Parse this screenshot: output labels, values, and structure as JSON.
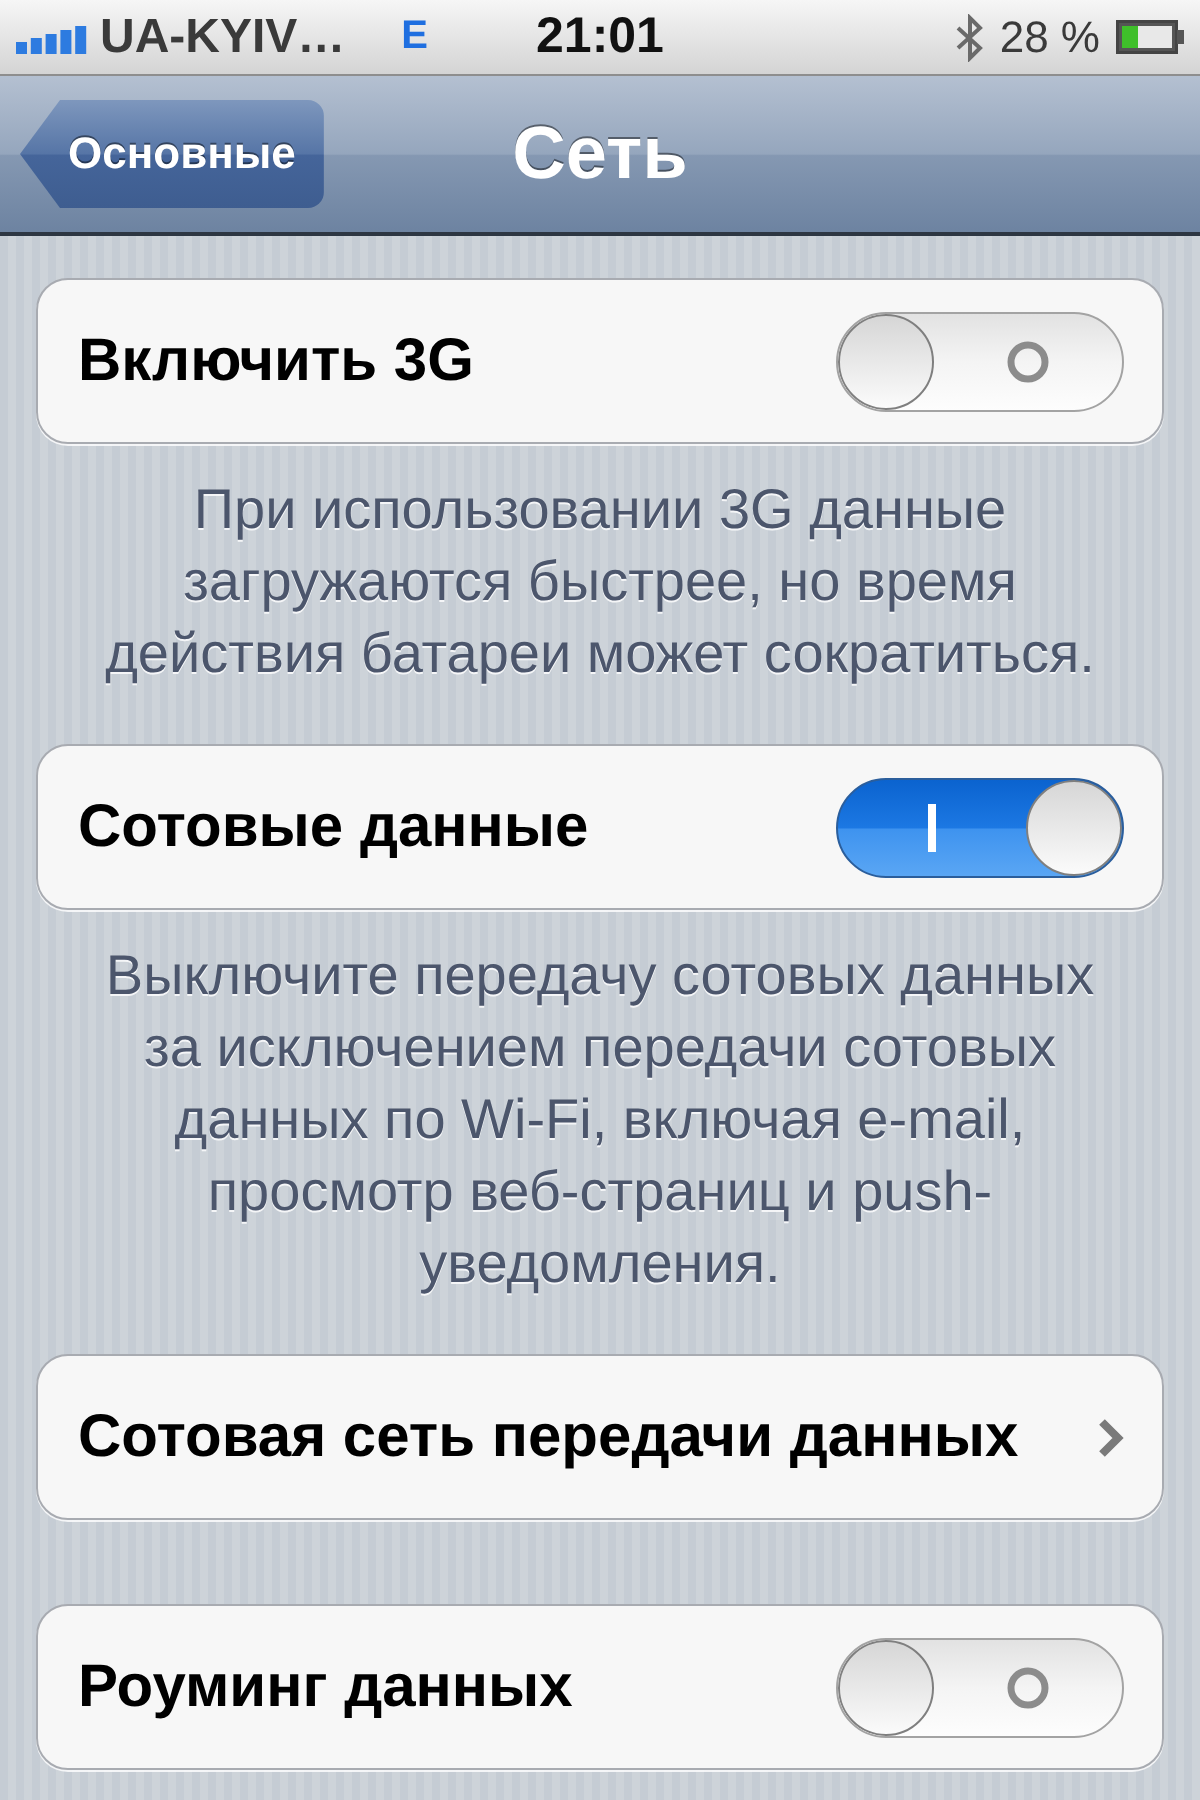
{
  "status_bar": {
    "carrier": "UA-KYIV…",
    "network": "E",
    "time": "21:01",
    "battery": "28 %"
  },
  "nav_bar": {
    "back_button": "Основные",
    "title": "Сеть"
  },
  "sections": [
    {
      "cells": [
        {
          "kind": "toggle",
          "label": "Включить 3G",
          "on": false
        }
      ],
      "footer": "При использовании 3G данные загружаются быстрее, но время действия батареи может сократиться."
    },
    {
      "cells": [
        {
          "kind": "toggle",
          "label": "Сотовые данные",
          "on": true
        }
      ],
      "footer": "Выключите передачу сотовых данных за исключением передачи сотовых данных по Wi-Fi, включая e-mail, просмотр веб-страниц и push-уведомления."
    },
    {
      "cells": [
        {
          "kind": "disclosure",
          "label": "Сотовая сеть передачи данных"
        }
      ]
    },
    {
      "cells": [
        {
          "kind": "toggle",
          "label": "Роуминг данных",
          "on": false
        }
      ]
    }
  ]
}
